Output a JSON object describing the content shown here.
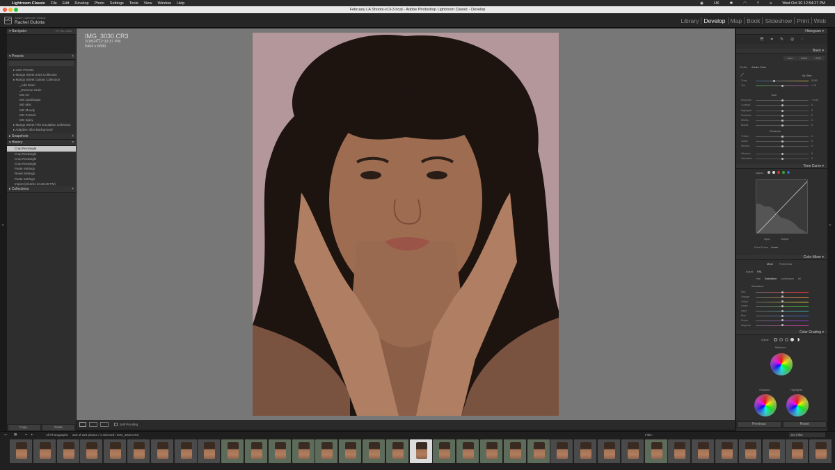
{
  "macbar": {
    "app": "Lightroom Classic",
    "menus": [
      "File",
      "Edit",
      "Develop",
      "Photo",
      "Settings",
      "Tools",
      "View",
      "Window",
      "Help"
    ],
    "lang": "UK",
    "datetime": "Wed Oct 30  12:54:27 PM"
  },
  "window": {
    "title": "February LA Shoots-v13-3.lrcat - Adobe Photoshop Lightroom Classic - Develop"
  },
  "identity": {
    "plate": "Adobe Lightroom Classic",
    "name": "Rachel Gulotta"
  },
  "modules": [
    "Library",
    "Develop",
    "Map",
    "Book",
    "Slideshow",
    "Print",
    "Web"
  ],
  "left": {
    "navigator": {
      "label": "Navigator",
      "options": "FIT  FILL  100%"
    },
    "presets": {
      "label": "Presets",
      "items": [
        {
          "text": "User Presets",
          "indent": 0
        },
        {
          "text": "Mango Street 2024 Collection",
          "indent": 0
        },
        {
          "text": "Mango Street Classic Collection",
          "indent": 0
        },
        {
          "text": "_Add Grain",
          "indent": 1
        },
        {
          "text": "_Remove Grain",
          "indent": 1
        },
        {
          "text": "MG Art",
          "indent": 1
        },
        {
          "text": "MG Landscape",
          "indent": 1
        },
        {
          "text": "MG Mist",
          "indent": 1
        },
        {
          "text": "MG Moody",
          "indent": 1
        },
        {
          "text": "MG Portrait",
          "indent": 1
        },
        {
          "text": "MG Spicy",
          "indent": 1
        },
        {
          "text": "Mango Street Film Emulation Collection",
          "indent": 0
        },
        {
          "text": "Adaptive: Blur Background",
          "indent": 0
        }
      ]
    },
    "snapshots": {
      "label": "Snapshots"
    },
    "history": {
      "label": "History",
      "items": [
        "Crop Rectangle",
        "Crop Rectangle",
        "Crop Rectangle",
        "Crop Rectangle",
        "Paste Settings",
        "Reset Settings",
        "Paste Settings",
        "Import (2/18/24 10:36:49 PM)"
      ]
    },
    "collections": {
      "label": "Collections"
    },
    "copy": "Copy...",
    "paste": "Paste"
  },
  "image": {
    "filename": "IMG_3030.CR3",
    "date": "2/18/24 12:32:37 PM",
    "dims": "5464 x 6830"
  },
  "toolbar": {
    "soft_proof": "Soft Proofing"
  },
  "right": {
    "histogram": "Histogram",
    "basic": {
      "label": "Basic",
      "auto": "Auto",
      "bw": "B&W",
      "hdr": "HDR",
      "profile_label": "Profile",
      "profile": "Adobe Color",
      "wb": "As Shot",
      "sliders": [
        {
          "name": "Temp",
          "pos": 0.35,
          "val": "5,050"
        },
        {
          "name": "Tint",
          "pos": 0.5,
          "val": "+ 10"
        },
        {
          "name": "Exposure",
          "pos": 0.5,
          "val": "+ 0.00"
        },
        {
          "name": "Contrast",
          "pos": 0.5,
          "val": "0"
        },
        {
          "name": "Highlights",
          "pos": 0.5,
          "val": "0"
        },
        {
          "name": "Shadows",
          "pos": 0.5,
          "val": "0"
        },
        {
          "name": "Whites",
          "pos": 0.5,
          "val": "0"
        },
        {
          "name": "Blacks",
          "pos": 0.5,
          "val": "0"
        },
        {
          "name": "Texture",
          "pos": 0.5,
          "val": "0"
        },
        {
          "name": "Clarity",
          "pos": 0.5,
          "val": "0"
        },
        {
          "name": "Dehaze",
          "pos": 0.5,
          "val": "0"
        },
        {
          "name": "Vibrance",
          "pos": 0.5,
          "val": "0"
        },
        {
          "name": "Saturation",
          "pos": 0.5,
          "val": "0"
        }
      ],
      "tone": "Tone",
      "presence": "Presence"
    },
    "tone_curve": {
      "label": "Tone Curve",
      "adjust": "Adjust",
      "input": "Input",
      "output": "Output",
      "point_curve": "Point Curve",
      "linear": "Linear"
    },
    "color_mixer": {
      "label": "Color Mixer",
      "mixer": "Mixer",
      "point_color": "Point Color",
      "adjust": "Adjust",
      "hsl": "HSL",
      "tabs": [
        "Hue",
        "Saturation",
        "Luminance",
        "All"
      ],
      "sub": "Saturation",
      "rows": [
        "Red",
        "Orange",
        "Yellow",
        "Green",
        "Aqua",
        "Blue",
        "Purple",
        "Magenta"
      ]
    },
    "color_grading": {
      "label": "Color Grading",
      "adjust": "Adjust",
      "midtones": "Midtones",
      "shadows": "Shadows",
      "highlights": "Highlights"
    },
    "previous": "Previous",
    "reset": "Reset"
  },
  "filmbar": {
    "source": "All Photographs",
    "count": "220 of 220 photos / 1 selected / IMG_3030.CR3",
    "filter": "Filter :",
    "nofilter": "No Filter"
  }
}
